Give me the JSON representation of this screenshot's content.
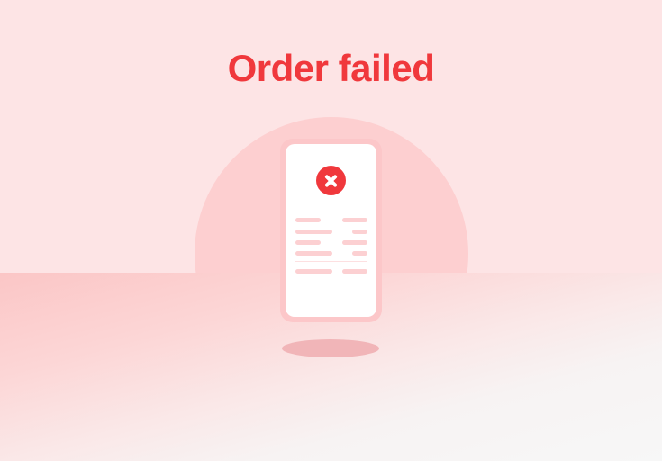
{
  "page": {
    "title": "Order failed"
  },
  "colors": {
    "accent": "#f0383c",
    "background": "#fde4e5",
    "circle": "#fdcfd0",
    "phone_frame": "#fcc7c9",
    "placeholder_line": "#fcd0d2"
  },
  "illustration": {
    "status_icon": "close-icon"
  }
}
